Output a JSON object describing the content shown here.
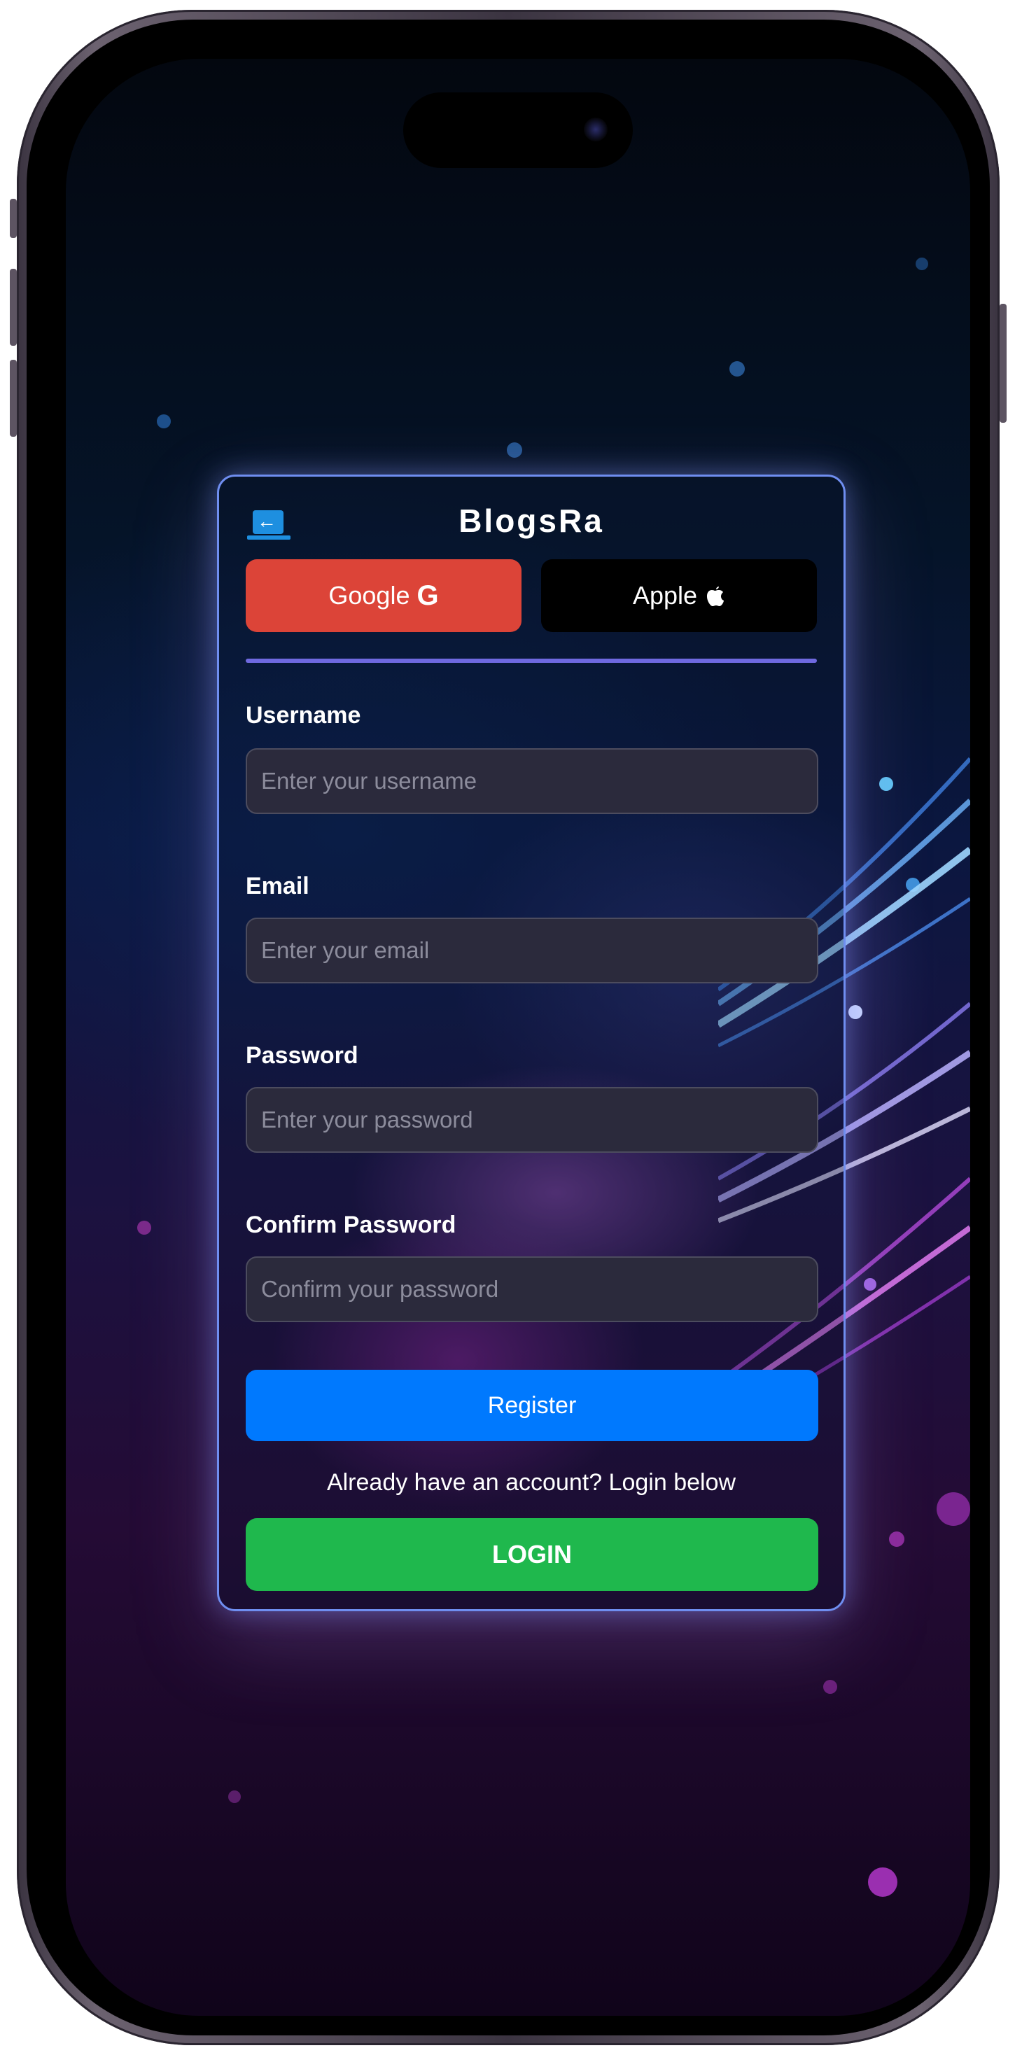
{
  "app": {
    "brand": "BlogsRa"
  },
  "social": {
    "google_label": "Google",
    "google_icon": "google-g-icon",
    "apple_label": "Apple",
    "apple_icon": "apple-icon"
  },
  "form": {
    "username": {
      "label": "Username",
      "placeholder": "Enter your username",
      "value": ""
    },
    "email": {
      "label": "Email",
      "placeholder": "Enter your email",
      "value": ""
    },
    "password": {
      "label": "Password",
      "placeholder": "Enter your password",
      "value": ""
    },
    "confirm_password": {
      "label": "Confirm Password",
      "placeholder": "Confirm your password",
      "value": ""
    },
    "register_label": "Register"
  },
  "login": {
    "prompt": "Already have an account? Login below",
    "button_label": "LOGIN"
  },
  "colors": {
    "google": "#dc4438",
    "apple": "#000000",
    "register": "#0079fe",
    "login": "#1fb84d",
    "card_border": "#6f8ef0",
    "divider": "#6f69e0"
  },
  "icons": {
    "back": "back-arrow-icon"
  }
}
